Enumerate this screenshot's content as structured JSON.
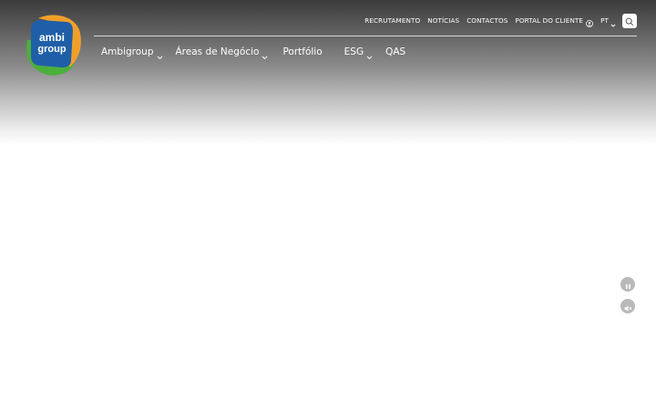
{
  "brand": {
    "logo_line1": "ambi",
    "logo_line2": "group",
    "colors": {
      "blue": "#1f5fa8",
      "orange": "#f0a02a",
      "green": "#4caf3c"
    }
  },
  "top_bar": {
    "links": [
      {
        "label": "RECRUTAMENTO"
      },
      {
        "label": "NOTÍCIAS"
      },
      {
        "label": "CONTACTOS"
      },
      {
        "label": "PORTAL DO CLIENTE",
        "icon": "user-icon"
      },
      {
        "label": "PT",
        "icon": "chevron-down-icon"
      }
    ],
    "search_icon": "search-icon"
  },
  "main_nav": {
    "items": [
      {
        "label": "Ambigroup",
        "has_dropdown": true
      },
      {
        "label": "Áreas de Negócio",
        "has_dropdown": true
      },
      {
        "label": "Portfólio",
        "has_dropdown": false
      },
      {
        "label": "ESG",
        "has_dropdown": true
      },
      {
        "label": "QAS",
        "has_dropdown": false
      }
    ]
  },
  "media_controls": {
    "pause_icon": "pause-icon",
    "mute_icon": "mute-icon"
  }
}
